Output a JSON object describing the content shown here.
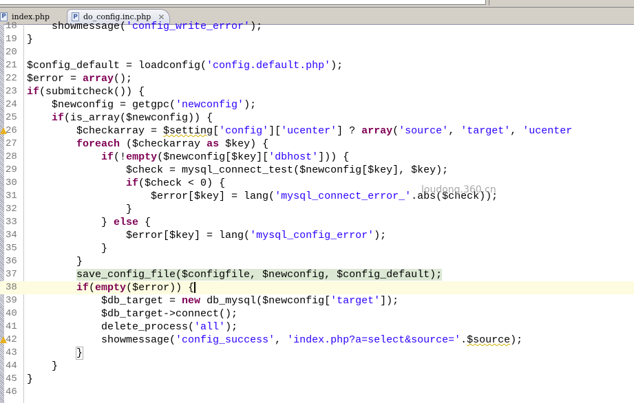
{
  "tabs": [
    {
      "label": "index.php",
      "icon": "P",
      "active": false
    },
    {
      "label": "do_config.inc.php",
      "icon": "P",
      "active": true,
      "close": "✕"
    }
  ],
  "watermark": "loudong.360.cn",
  "lines": [
    {
      "n": "18",
      "text": "    showmessage('config_write_error');"
    },
    {
      "n": "19",
      "text": "}"
    },
    {
      "n": "20",
      "text": ""
    },
    {
      "n": "21",
      "text": "$config_default = loadconfig('config.default.php');"
    },
    {
      "n": "22",
      "text": "$error = array();"
    },
    {
      "n": "23",
      "text": "if(submitcheck()) {"
    },
    {
      "n": "24",
      "text": "    $newconfig = getgpc('newconfig');"
    },
    {
      "n": "25",
      "text": "    if(is_array($newconfig)) {"
    },
    {
      "n": "26",
      "text": "        $checkarray = $setting['config']['ucenter'] ? array('source', 'target', 'ucenter",
      "warning": true
    },
    {
      "n": "27",
      "text": "        foreach ($checkarray as $key) {"
    },
    {
      "n": "28",
      "text": "            if(!empty($newconfig[$key]['dbhost'])) {"
    },
    {
      "n": "29",
      "text": "                $check = mysql_connect_test($newconfig[$key], $key);"
    },
    {
      "n": "30",
      "text": "                if($check < 0) {"
    },
    {
      "n": "31",
      "text": "                    $error[$key] = lang('mysql_connect_error_'.abs($check));"
    },
    {
      "n": "32",
      "text": "                }"
    },
    {
      "n": "33",
      "text": "            } else {"
    },
    {
      "n": "34",
      "text": "                $error[$key] = lang('mysql_config_error');"
    },
    {
      "n": "35",
      "text": "            }"
    },
    {
      "n": "36",
      "text": "        }"
    },
    {
      "n": "37",
      "text": "        save_config_file($configfile, $newconfig, $config_default);",
      "highlight": "green"
    },
    {
      "n": "38",
      "text": "        if(empty($error)) {",
      "highlight": "yellow",
      "caret": true
    },
    {
      "n": "39",
      "text": "            $db_target = new db_mysql($newconfig['target']);"
    },
    {
      "n": "40",
      "text": "            $db_target->connect();"
    },
    {
      "n": "41",
      "text": "            delete_process('all');"
    },
    {
      "n": "42",
      "text": "            showmessage('config_success', 'index.php?a=select&source='.$source);",
      "warning": true
    },
    {
      "n": "43",
      "text": "        }",
      "bracket": true
    },
    {
      "n": "44",
      "text": "    }"
    },
    {
      "n": "45",
      "text": "}"
    },
    {
      "n": "46",
      "text": ""
    }
  ]
}
